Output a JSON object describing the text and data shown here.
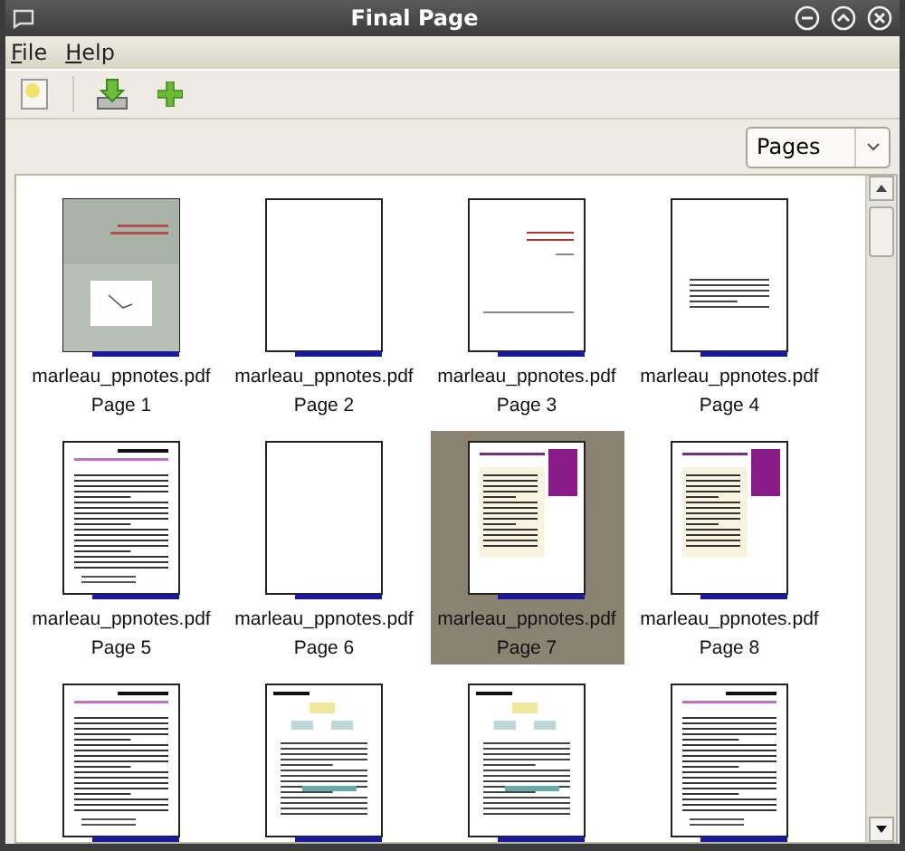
{
  "window": {
    "title": "Final Page"
  },
  "menu": [
    {
      "label": "File"
    },
    {
      "label": "Help"
    }
  ],
  "view_select": {
    "value": "Pages"
  },
  "pages": [
    {
      "file": "marleau_ppnotes.pdf",
      "page": "Page 1",
      "selected": false,
      "kind": "cover"
    },
    {
      "file": "marleau_ppnotes.pdf",
      "page": "Page 2",
      "selected": false,
      "kind": "blank"
    },
    {
      "file": "marleau_ppnotes.pdf",
      "page": "Page 3",
      "selected": false,
      "kind": "title"
    },
    {
      "file": "marleau_ppnotes.pdf",
      "page": "Page 4",
      "selected": false,
      "kind": "abstract"
    },
    {
      "file": "marleau_ppnotes.pdf",
      "page": "Page 5",
      "selected": false,
      "kind": "text"
    },
    {
      "file": "marleau_ppnotes.pdf",
      "page": "Page 6",
      "selected": false,
      "kind": "blank"
    },
    {
      "file": "marleau_ppnotes.pdf",
      "page": "Page 7",
      "selected": true,
      "kind": "contents"
    },
    {
      "file": "marleau_ppnotes.pdf",
      "page": "Page 8",
      "selected": false,
      "kind": "contents"
    },
    {
      "selected": false,
      "kind": "text"
    },
    {
      "selected": false,
      "kind": "diagram"
    },
    {
      "selected": false,
      "kind": "diagram"
    },
    {
      "selected": false,
      "kind": "text"
    }
  ]
}
